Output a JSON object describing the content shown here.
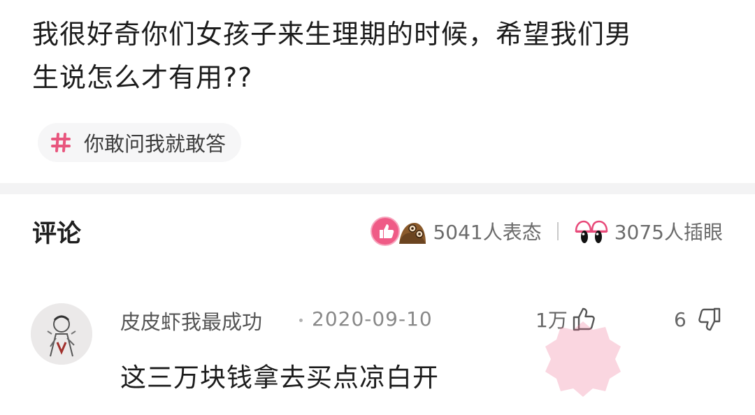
{
  "post": {
    "question_line1": "我很好奇你们女孩子来生理期的时候，希望我们男",
    "question_line2": "生说怎么才有用??",
    "topic": {
      "icon": "hash-icon",
      "label": "你敢问我就敢答"
    }
  },
  "comments_header": {
    "title": "评论",
    "reactions": {
      "react_count_text": "5041人表态",
      "peek_count_text": "3075人插眼",
      "icons": [
        "thumb-up-reaction-icon",
        "mole-reaction-icon",
        "eyes-reaction-icon"
      ]
    }
  },
  "comment": {
    "author": "皮皮虾我最成功",
    "date": "2020-09-10",
    "like_count": "1万",
    "dislike_count": "6",
    "text": "这三万块钱拿去买点凉白开"
  },
  "colors": {
    "accent_pink": "#e84a7a",
    "text_primary": "#1c1c1c",
    "text_secondary": "#888888",
    "tag_bg": "#f6f6f7"
  }
}
